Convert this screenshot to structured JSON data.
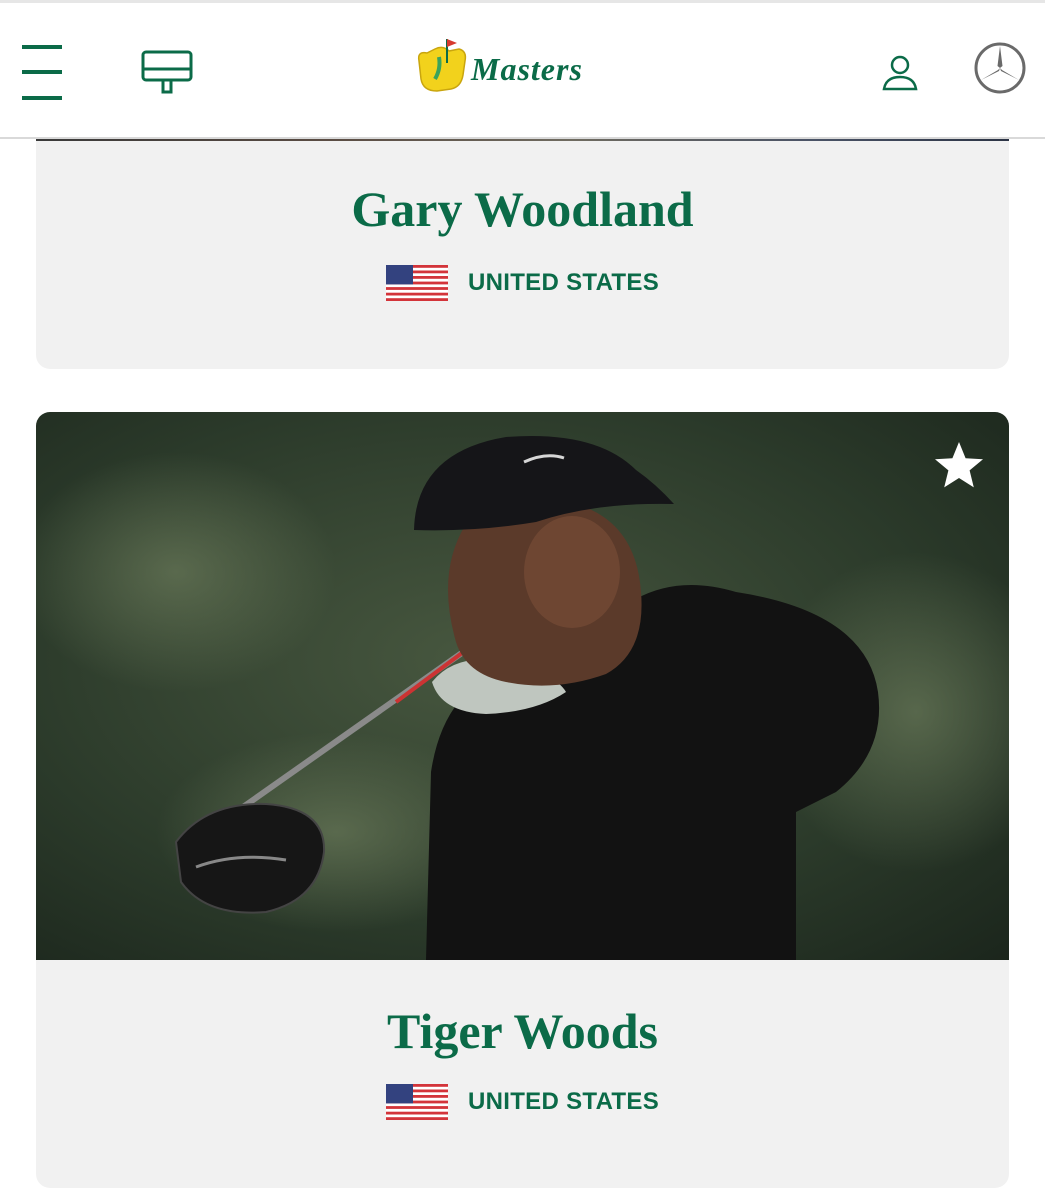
{
  "header": {
    "logo_text": "Masters",
    "icons": {
      "menu": "hamburger-menu-icon",
      "leaderboard": "leaderboard-icon",
      "user": "user-account-icon",
      "sponsor": "mercedes-star-icon"
    }
  },
  "players": [
    {
      "name": "Gary Woodland",
      "country": "UNITED STATES",
      "flag": "us-flag"
    },
    {
      "name": "Tiger Woods",
      "country": "UNITED STATES",
      "flag": "us-flag",
      "favorite_icon": "star-icon"
    }
  ],
  "colors": {
    "brand_green": "#0b6b48",
    "card_bg": "#f1f1f1",
    "masters_yellow": "#f2d21c"
  }
}
